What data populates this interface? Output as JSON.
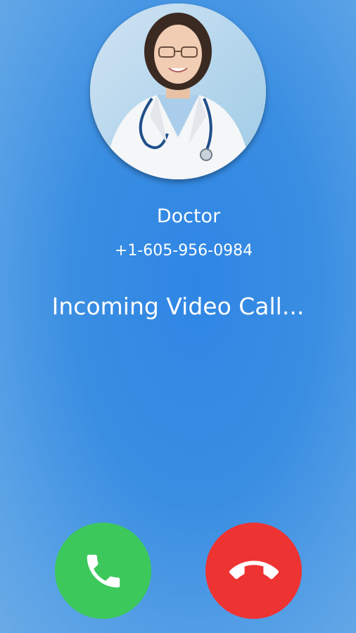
{
  "caller": {
    "name": "Doctor",
    "number": "+1-605-956-0984"
  },
  "call": {
    "status": "Incoming Video Call..."
  },
  "avatar": {
    "icon": "doctor-avatar-photo"
  },
  "actions": {
    "accept_icon": "phone-icon",
    "decline_icon": "hangup-icon",
    "accept_color": "#3dc85c",
    "decline_color": "#ee3333"
  },
  "colors": {
    "background": "#3a8ee2",
    "text": "#ffffff"
  }
}
